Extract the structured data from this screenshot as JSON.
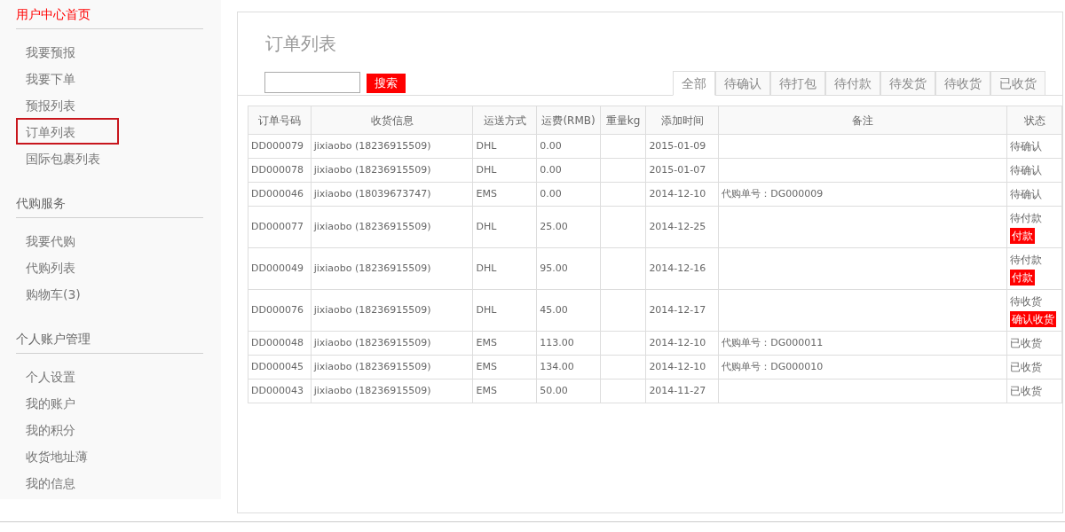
{
  "sidebar": {
    "sections": [
      {
        "title": "用户中心首页",
        "kind": "home",
        "items": [
          {
            "label": "我要预报",
            "selected": false
          },
          {
            "label": "我要下单",
            "selected": false
          },
          {
            "label": "预报列表",
            "selected": false
          },
          {
            "label": "订单列表",
            "selected": true
          },
          {
            "label": "国际包裹列表",
            "selected": false
          }
        ]
      },
      {
        "title": "代购服务",
        "kind": "group",
        "items": [
          {
            "label": "我要代购",
            "selected": false
          },
          {
            "label": "代购列表",
            "selected": false
          },
          {
            "label": "购物车(3)",
            "selected": false
          }
        ]
      },
      {
        "title": "个人账户管理",
        "kind": "group",
        "items": [
          {
            "label": "个人设置",
            "selected": false
          },
          {
            "label": "我的账户",
            "selected": false
          },
          {
            "label": "我的积分",
            "selected": false
          },
          {
            "label": "收货地址薄",
            "selected": false
          },
          {
            "label": "我的信息",
            "selected": false
          }
        ]
      }
    ]
  },
  "page_title": "订单列表",
  "search": {
    "button": "搜索"
  },
  "tabs": [
    {
      "label": "全部",
      "selected": true
    },
    {
      "label": "待确认",
      "selected": false
    },
    {
      "label": "待打包",
      "selected": false
    },
    {
      "label": "待付款",
      "selected": false
    },
    {
      "label": "待发货",
      "selected": false
    },
    {
      "label": "待收货",
      "selected": false
    },
    {
      "label": "已收货",
      "selected": false
    }
  ],
  "table": {
    "columns": [
      "订单号码",
      "收货信息",
      "运送方式",
      "运费(RMB)",
      "重量kg",
      "添加时间",
      "备注",
      "状态"
    ],
    "rows": [
      {
        "order": "DD000079",
        "receiver": "jixiaobo (18236915509)",
        "shipping": "DHL",
        "fee": "0.00",
        "weight": "",
        "added": "2015-01-09",
        "note": "",
        "status": "待确认"
      },
      {
        "order": "DD000078",
        "receiver": "jixiaobo (18236915509)",
        "shipping": "DHL",
        "fee": "0.00",
        "weight": "",
        "added": "2015-01-07",
        "note": "",
        "status": "待确认"
      },
      {
        "order": "DD000046",
        "receiver": "jixiaobo (18039673747)",
        "shipping": "EMS",
        "fee": "0.00",
        "weight": "",
        "added": "2014-12-10",
        "note": "代购单号：DG000009",
        "status": "待确认"
      },
      {
        "order": "DD000077",
        "receiver": "jixiaobo (18236915509)",
        "shipping": "DHL",
        "fee": "25.00",
        "weight": "",
        "added": "2014-12-25",
        "note": "",
        "status": "待付款",
        "action": "付款"
      },
      {
        "order": "DD000049",
        "receiver": "jixiaobo (18236915509)",
        "shipping": "DHL",
        "fee": "95.00",
        "weight": "",
        "added": "2014-12-16",
        "note": "",
        "status": "待付款",
        "action": "付款"
      },
      {
        "order": "DD000076",
        "receiver": "jixiaobo (18236915509)",
        "shipping": "DHL",
        "fee": "45.00",
        "weight": "",
        "added": "2014-12-17",
        "note": "",
        "status": "待收货",
        "action": "确认收货"
      },
      {
        "order": "DD000048",
        "receiver": "jixiaobo (18236915509)",
        "shipping": "EMS",
        "fee": "113.00",
        "weight": "",
        "added": "2014-12-10",
        "note": "代购单号：DG000011",
        "status": "已收货"
      },
      {
        "order": "DD000045",
        "receiver": "jixiaobo (18236915509)",
        "shipping": "EMS",
        "fee": "134.00",
        "weight": "",
        "added": "2014-12-10",
        "note": "代购单号：DG000010",
        "status": "已收货"
      },
      {
        "order": "DD000043",
        "receiver": "jixiaobo (18236915509)",
        "shipping": "EMS",
        "fee": "50.00",
        "weight": "",
        "added": "2014-11-27",
        "note": "",
        "status": "已收货"
      }
    ]
  }
}
